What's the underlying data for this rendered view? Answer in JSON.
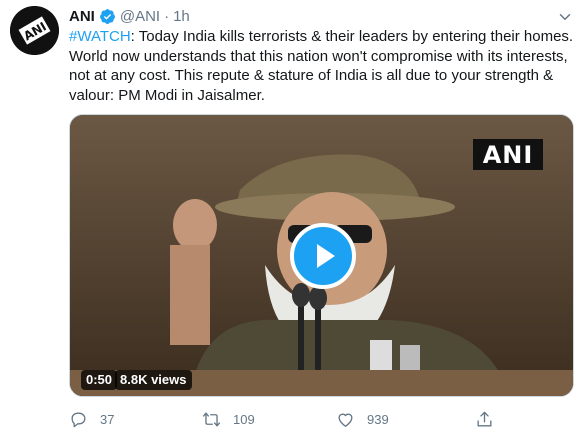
{
  "tweet": {
    "name": "ANI",
    "handle": "@ANI",
    "separator": "·",
    "time": "1h",
    "hashtag": "#WATCH",
    "text": ": Today India kills terrorists & their leaders by entering their homes. World now understands that this nation won't compromise with its interests, not at any cost. This repute & stature of India is all due to your strength & valour: PM Modi in Jaisalmer."
  },
  "avatar": {
    "logo_text": "ANI"
  },
  "media": {
    "watermark": "ANI",
    "duration": "0:50",
    "views": "8.8K views"
  },
  "actions": {
    "replies": "37",
    "retweets": "109",
    "likes": "939"
  },
  "colors": {
    "accent": "#1da1f2",
    "secondary_text": "#657786",
    "primary_text": "#14171a"
  }
}
